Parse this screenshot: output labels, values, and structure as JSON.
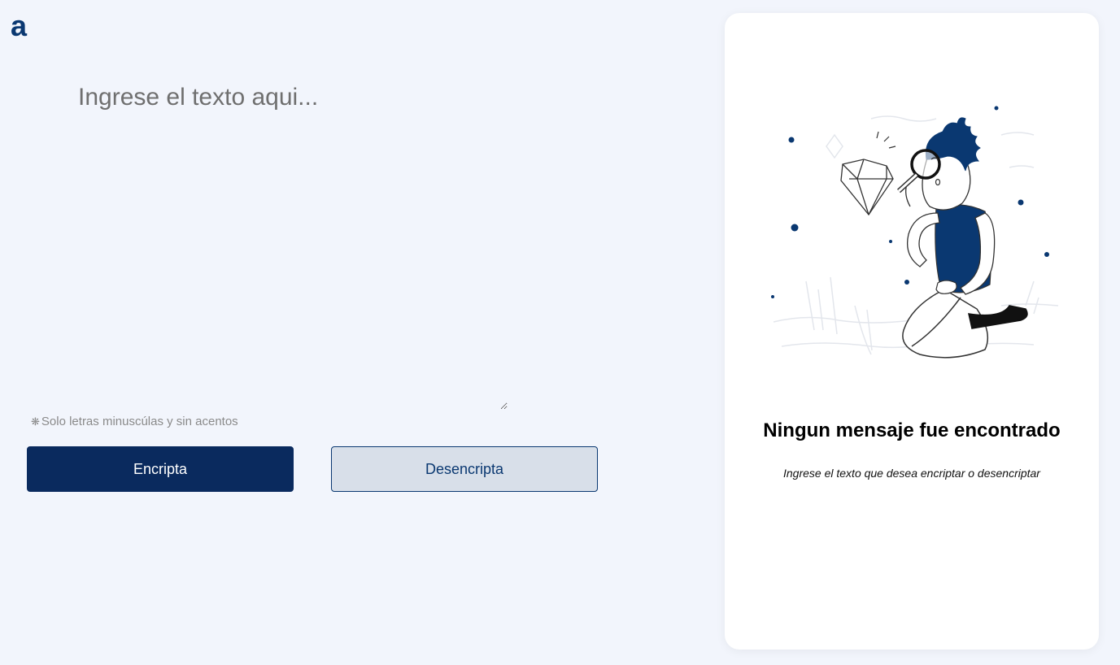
{
  "logo": {
    "letter": "a",
    "color": "#0a3871"
  },
  "input": {
    "placeholder": "Ingrese el texto aqui...",
    "value": ""
  },
  "hint": {
    "icon": "asterisk-icon",
    "text": "Solo letras minuscúlas y sin acentos"
  },
  "buttons": {
    "encrypt_label": "Encripta",
    "decrypt_label": "Desencripta"
  },
  "result_panel": {
    "illustration": "person-with-magnifying-glass-illustration",
    "title": "Ningun mensaje fue encontrado",
    "subtitle": "Ingrese el texto que desea encriptar o desencriptar"
  },
  "colors": {
    "background": "#f2f5fc",
    "primary": "#0a2a5e",
    "secondary_bg": "#d8dfe9",
    "panel": "#ffffff"
  }
}
